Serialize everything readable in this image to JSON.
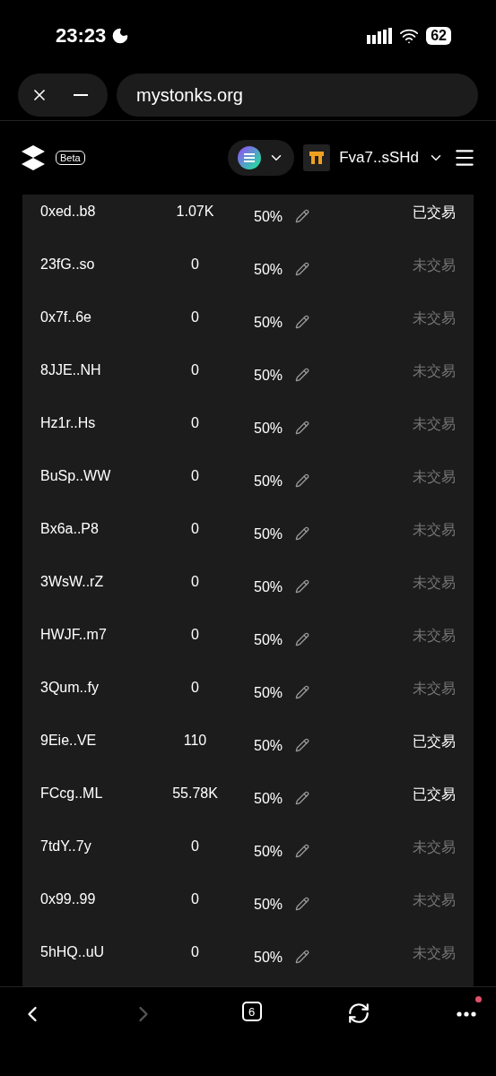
{
  "status_bar": {
    "time": "23:23",
    "battery": "62"
  },
  "browser": {
    "url": "mystonks.org",
    "tab_count": "6"
  },
  "header": {
    "badge": "Beta",
    "wallet": "Fva7..sSHd"
  },
  "rows": [
    {
      "address": "0xed..b8",
      "amount": "1.07K",
      "percent": "50%",
      "status": "已交易",
      "traded": true
    },
    {
      "address": "23fG..so",
      "amount": "0",
      "percent": "50%",
      "status": "未交易",
      "traded": false
    },
    {
      "address": "0x7f..6e",
      "amount": "0",
      "percent": "50%",
      "status": "未交易",
      "traded": false
    },
    {
      "address": "8JJE..NH",
      "amount": "0",
      "percent": "50%",
      "status": "未交易",
      "traded": false
    },
    {
      "address": "Hz1r..Hs",
      "amount": "0",
      "percent": "50%",
      "status": "未交易",
      "traded": false
    },
    {
      "address": "BuSp..WW",
      "amount": "0",
      "percent": "50%",
      "status": "未交易",
      "traded": false
    },
    {
      "address": "Bx6a..P8",
      "amount": "0",
      "percent": "50%",
      "status": "未交易",
      "traded": false
    },
    {
      "address": "3WsW..rZ",
      "amount": "0",
      "percent": "50%",
      "status": "未交易",
      "traded": false
    },
    {
      "address": "HWJF..m7",
      "amount": "0",
      "percent": "50%",
      "status": "未交易",
      "traded": false
    },
    {
      "address": "3Qum..fy",
      "amount": "0",
      "percent": "50%",
      "status": "未交易",
      "traded": false
    },
    {
      "address": "9Eie..VE",
      "amount": "110",
      "percent": "50%",
      "status": "已交易",
      "traded": true
    },
    {
      "address": "FCcg..ML",
      "amount": "55.78K",
      "percent": "50%",
      "status": "已交易",
      "traded": true
    },
    {
      "address": "7tdY..7y",
      "amount": "0",
      "percent": "50%",
      "status": "未交易",
      "traded": false
    },
    {
      "address": "0x99..99",
      "amount": "0",
      "percent": "50%",
      "status": "未交易",
      "traded": false
    },
    {
      "address": "5hHQ..uU",
      "amount": "0",
      "percent": "50%",
      "status": "未交易",
      "traded": false
    }
  ]
}
